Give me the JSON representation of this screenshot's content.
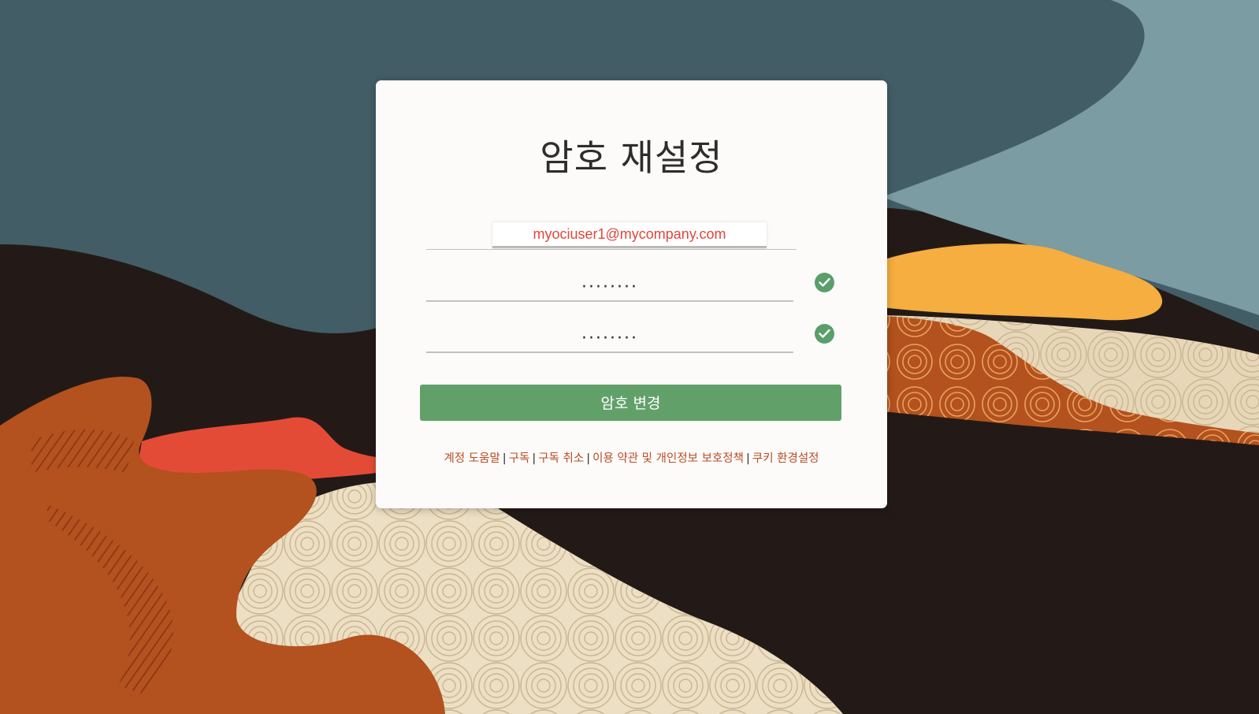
{
  "page": {
    "title": "암호 재설정"
  },
  "form": {
    "email_value": "myociuser1@mycompany.com",
    "new_password_value": "········",
    "confirm_password_value": "········",
    "submit_label": "암호 변경",
    "check_icon": "checkmark-circle-icon"
  },
  "footer": {
    "links": [
      {
        "label": "계정 도움말"
      },
      {
        "label": "구독"
      },
      {
        "label": "구독 취소"
      },
      {
        "label": "이용 약관 및 개인정보 보호정책"
      },
      {
        "label": "쿠키 환경설정"
      }
    ],
    "separator": "|"
  },
  "colors": {
    "accent_button": "#62a06a",
    "check_icon": "#5a9e6a",
    "link": "#b84c22",
    "email_text": "#e1453b",
    "card_background": "#fcfbfa"
  }
}
